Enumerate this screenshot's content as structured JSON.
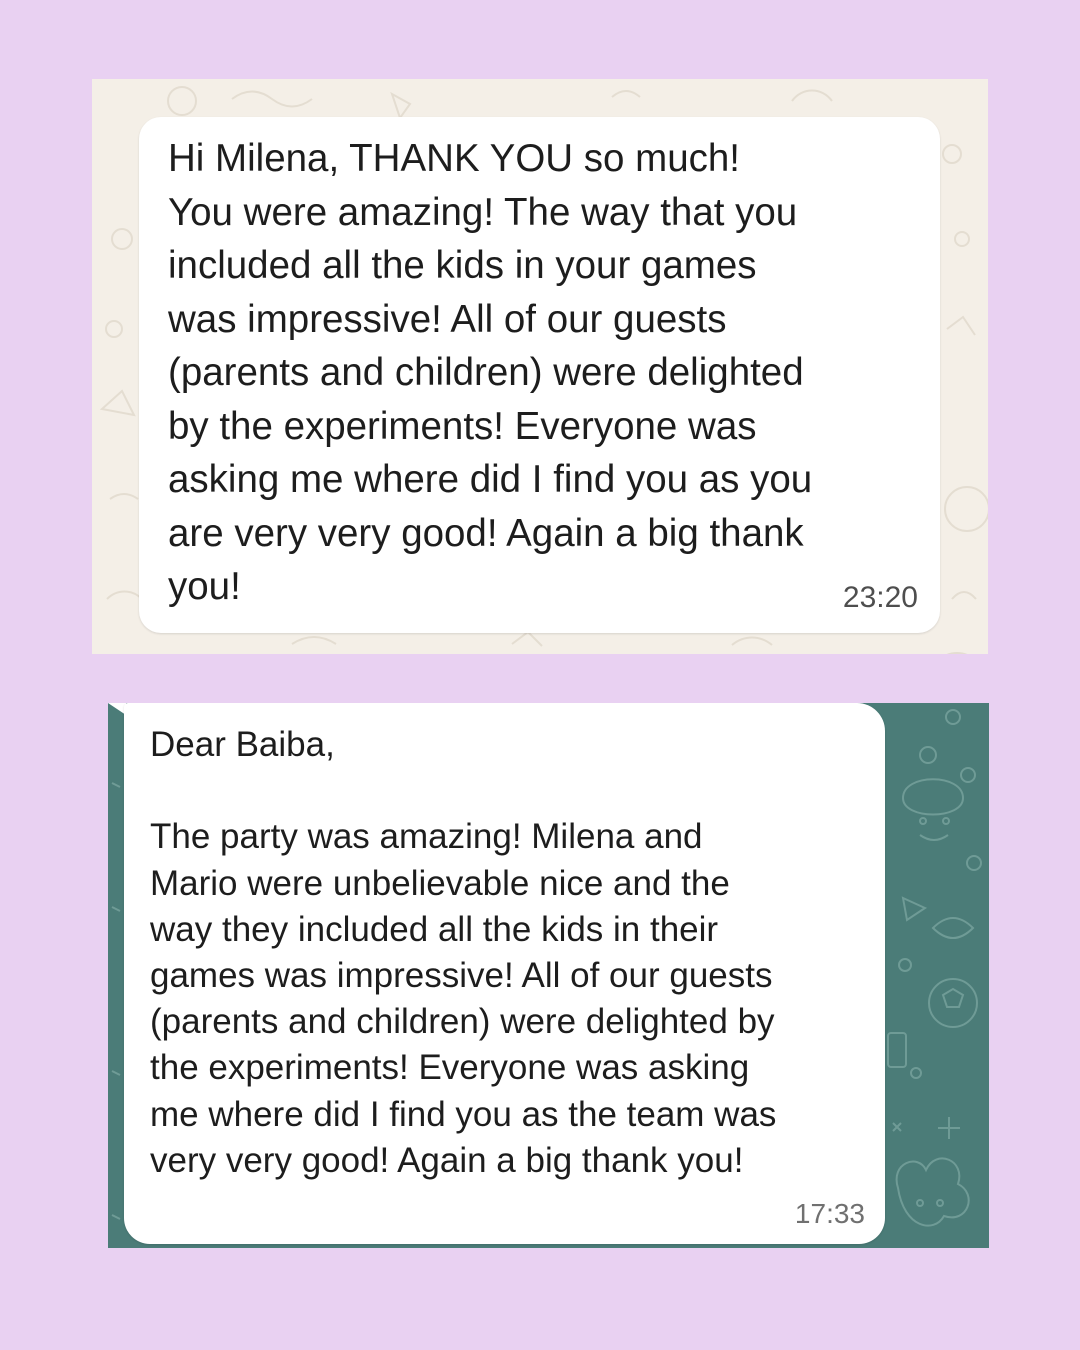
{
  "messages": [
    {
      "text": "Hi Milena, THANK YOU so much!\nYou were amazing! The way that you\nincluded all the kids in your games\nwas impressive! All of our guests\n(parents and children) were delighted\nby the experiments! Everyone was\nasking me where did I find you as you\nare very very good! Again a big thank\nyou!",
      "time": "23:20"
    },
    {
      "text": "Dear Baiba,\n\nThe party was amazing! Milena and\nMario were unbelievable nice and the\nway they included all the kids in their\ngames was impressive! All of our guests\n(parents and children) were delighted by\nthe experiments! Everyone was asking\nme where did I find you as the team was\nvery very good! Again a big thank you!",
      "time": "17:33"
    }
  ],
  "colors": {
    "page_background": "#e9d1f2",
    "chat1_wallpaper": "#f4efe7",
    "chat2_wallpaper": "#4b7c78",
    "bubble": "#ffffff"
  }
}
